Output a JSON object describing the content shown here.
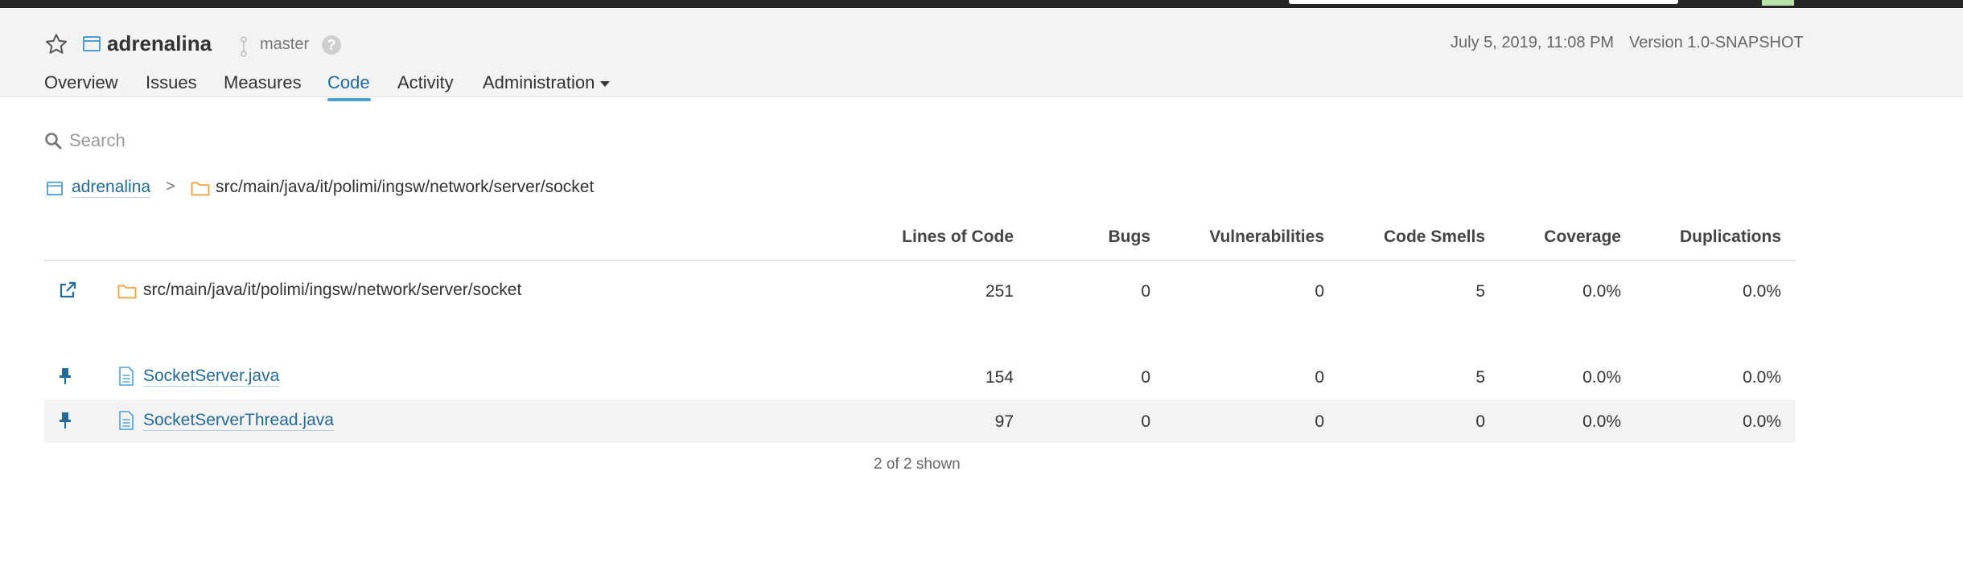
{
  "project": {
    "name": "adrenalina",
    "branch": "master",
    "date": "July 5, 2019, 11:08 PM",
    "version": "Version 1.0-SNAPSHOT",
    "help_symbol": "?"
  },
  "nav": {
    "overview": "Overview",
    "issues": "Issues",
    "measures": "Measures",
    "code": "Code",
    "activity": "Activity",
    "administration": "Administration",
    "active": "Code"
  },
  "search": {
    "placeholder": "Search"
  },
  "breadcrumb": {
    "project": "adrenalina",
    "separator": ">",
    "directory": "src/main/java/it/polimi/ingsw/network/server/socket"
  },
  "table": {
    "headers": {
      "lines_of_code": "Lines of Code",
      "bugs": "Bugs",
      "vulnerabilities": "Vulnerabilities",
      "code_smells": "Code Smells",
      "coverage": "Coverage",
      "duplications": "Duplications"
    },
    "base_row": {
      "name": "src/main/java/it/polimi/ingsw/network/server/socket",
      "lines_of_code": "251",
      "bugs": "0",
      "vulnerabilities": "0",
      "code_smells": "5",
      "coverage": "0.0%",
      "duplications": "0.0%"
    },
    "rows": [
      {
        "name": "SocketServer.java",
        "lines_of_code": "154",
        "bugs": "0",
        "vulnerabilities": "0",
        "code_smells": "5",
        "coverage": "0.0%",
        "duplications": "0.0%"
      },
      {
        "name": "SocketServerThread.java",
        "lines_of_code": "97",
        "bugs": "0",
        "vulnerabilities": "0",
        "code_smells": "0",
        "coverage": "0.0%",
        "duplications": "0.0%"
      }
    ],
    "shown": "2 of 2 shown"
  },
  "colors": {
    "link": "#236a97",
    "accent": "#4b9fd5",
    "folder": "#f0a33a",
    "header_bg": "#f3f3f3",
    "topbar": "#262626"
  },
  "icons": {
    "favorite": "star-icon",
    "project": "project-icon",
    "branch": "branch-icon",
    "help": "help-icon",
    "search": "search-icon",
    "folder": "folder-icon",
    "open": "external-link-icon",
    "pin": "pin-icon",
    "file": "file-icon"
  }
}
